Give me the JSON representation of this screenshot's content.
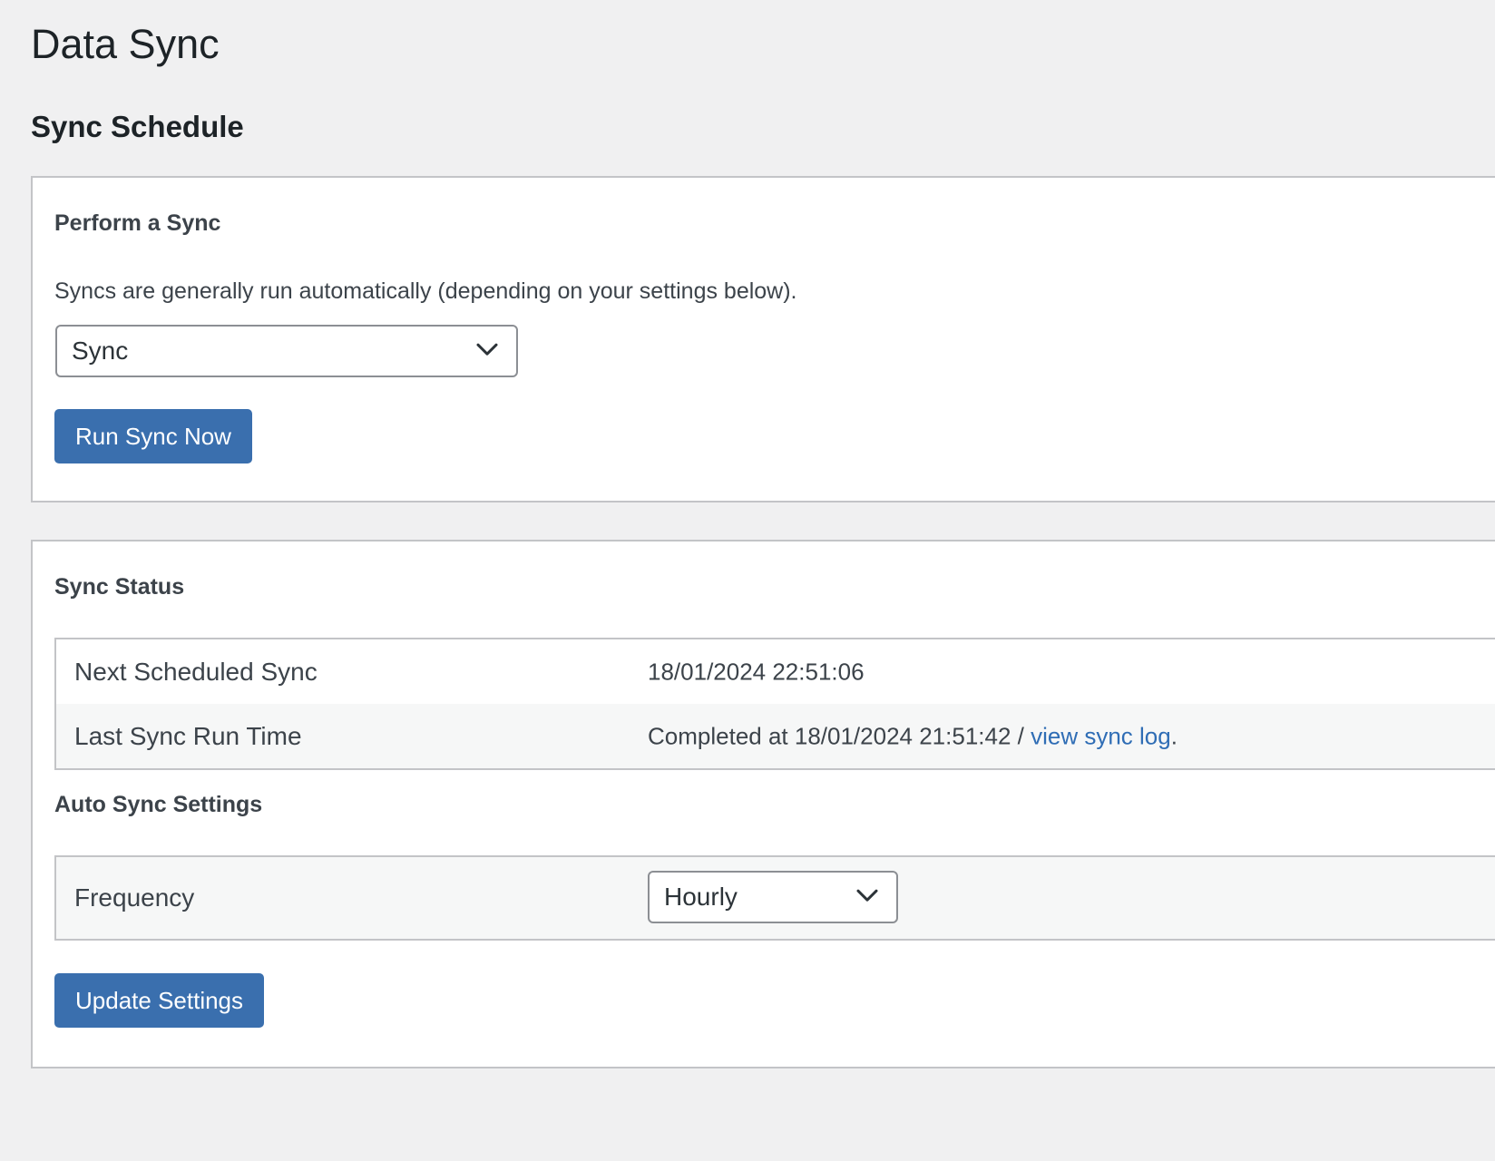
{
  "page": {
    "title": "Data Sync",
    "section_title": "Sync Schedule"
  },
  "perform_sync": {
    "heading": "Perform a Sync",
    "description": "Syncs are generally run automatically (depending on your settings below).",
    "select_value": "Sync",
    "run_button_label": "Run Sync Now"
  },
  "sync_status": {
    "heading": "Sync Status",
    "rows": [
      {
        "label": "Next Scheduled Sync",
        "value": "18/01/2024 22:51:06"
      },
      {
        "label": "Last Sync Run Time",
        "value_prefix": "Completed at 18/01/2024 21:51:42 / ",
        "link_text": "view sync log",
        "value_suffix": "."
      }
    ]
  },
  "auto_sync": {
    "heading": "Auto Sync Settings",
    "frequency_label": "Frequency",
    "frequency_value": "Hourly",
    "update_button_label": "Update Settings"
  },
  "colors": {
    "background": "#f0f0f1",
    "primary_button": "#3a6fae",
    "link": "#2f6db5",
    "panel_border": "#c3c4c7"
  }
}
